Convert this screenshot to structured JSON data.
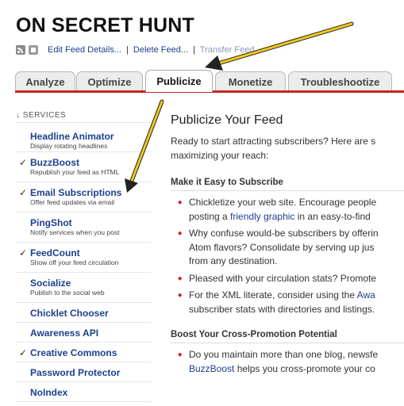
{
  "site_title": "ON SECRET HUNT",
  "feed_bar": {
    "edit": "Edit Feed Details...",
    "sep": "|",
    "delete": "Delete Feed...",
    "transfer": "Transfer Feed..."
  },
  "tabs": [
    "Analyze",
    "Optimize",
    "Publicize",
    "Monetize",
    "Troubleshootize"
  ],
  "active_tab": "Publicize",
  "sidebar": {
    "header": "↓ SERVICES",
    "items": [
      {
        "check": "",
        "name": "Headline Animator",
        "desc": "Display rotating headlines"
      },
      {
        "check": "✓",
        "name": "BuzzBoost",
        "desc": "Republish your feed as HTML"
      },
      {
        "check": "✓",
        "name": "Email Subscriptions",
        "desc": "Offer feed updates via email"
      },
      {
        "check": "",
        "name": "PingShot",
        "desc": "Notify services when you post"
      },
      {
        "check": "✓",
        "name": "FeedCount",
        "desc": "Show off your feed circulation"
      },
      {
        "check": "",
        "name": "Socialize",
        "desc": "Publish to the social web"
      },
      {
        "check": "",
        "name": "Chicklet Chooser",
        "desc": ""
      },
      {
        "check": "",
        "name": "Awareness API",
        "desc": ""
      },
      {
        "check": "✓",
        "name": "Creative Commons",
        "desc": ""
      },
      {
        "check": "",
        "name": "Password Protector",
        "desc": ""
      },
      {
        "check": "",
        "name": "NoIndex",
        "desc": ""
      }
    ]
  },
  "main": {
    "title": "Publicize Your Feed",
    "intro_1": "Ready to start attracting subscribers? Here are s",
    "intro_2": "maximizing your reach:",
    "section_1": "Make it Easy to Subscribe",
    "b1_l1": "Chickletize your web site. Encourage people",
    "b1_l2a": "posting a ",
    "b1_link": "friendly graphic",
    "b1_l2b": " in an easy-to-find",
    "b2_l1": "Why confuse would-be subscribers by offerin",
    "b2_l2": "Atom flavors? Consolidate by serving up jus",
    "b2_l3": "from any destination.",
    "b3_l1": "Pleased with your circulation stats? Promote",
    "b4_l1a": "For the XML literate, consider using the ",
    "b4_link": "Awa",
    "b4_l2": "subscriber stats with directories and listings.",
    "section_2": "Boost Your Cross-Promotion Potential",
    "b5_l1": "Do you maintain more than one blog, newsfe",
    "b5_link": "BuzzBoost",
    "b5_l2b": " helps you cross-promote your co"
  },
  "colors": {
    "accent_red": "#c32722",
    "link_blue": "#1d3f8f",
    "arrow_yellow": "#f0c81e"
  }
}
